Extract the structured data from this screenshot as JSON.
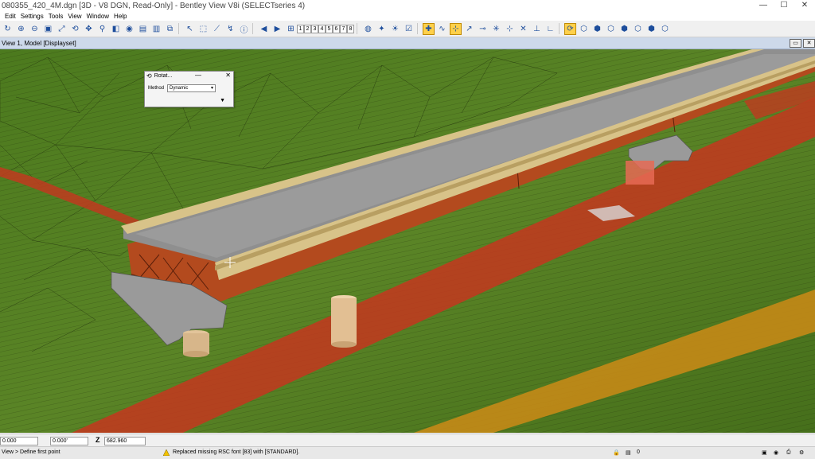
{
  "window": {
    "title": "080355_420_4M.dgn [3D - V8 DGN, Read-Only] - Bentley View V8i (SELECTseries 4)",
    "minimize": "—",
    "maximize": "☐",
    "close": "✕"
  },
  "menu": [
    "Edit",
    "Settings",
    "Tools",
    "View",
    "Window",
    "Help"
  ],
  "toolbar": {
    "view_numbers": [
      "1",
      "2",
      "3",
      "4",
      "5",
      "6",
      "7",
      "8"
    ]
  },
  "viewbar": {
    "title": "View 1, Model [Displayset]"
  },
  "dialog": {
    "title": "Rotat...",
    "method_label": "Method",
    "method_value": "Dynamic",
    "dropdown_glyph": "▾",
    "expand_glyph": "▼",
    "minimize": "—",
    "close": "✕"
  },
  "coords": {
    "x_value": "0.000",
    "y_value": "0.000'",
    "z_label": "Z",
    "z_value": "682.960"
  },
  "status": {
    "prompt": "View > Define first point",
    "message": "Replaced missing RSC font [83] with [STANDARD].",
    "level_value": "0"
  },
  "colors": {
    "terrain": "#4f7a1f",
    "red_band": "#c0391f",
    "orange_band": "#c88a17",
    "girder": "#b34a1e",
    "deck": "#8f8f8f",
    "parapet": "#d8c389",
    "accent_toolbar": "#ffd04a"
  }
}
